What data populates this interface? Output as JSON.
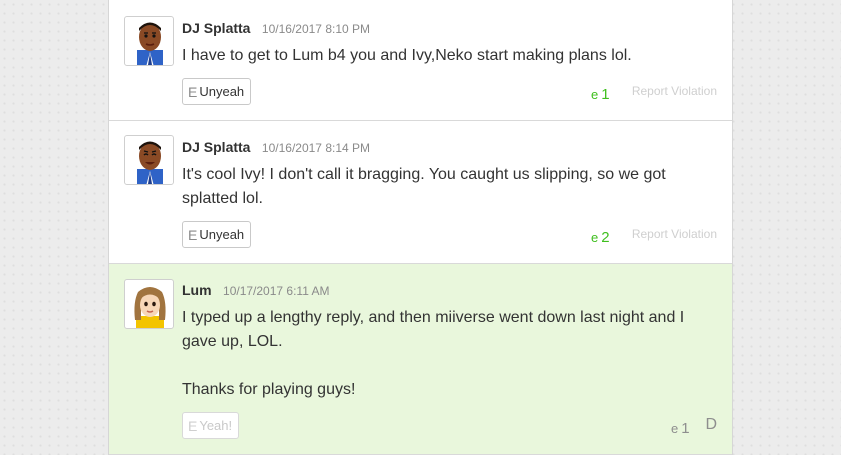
{
  "replies": [
    {
      "user": "DJ Splatta",
      "time": "10/16/2017 8:10 PM",
      "body": [
        "I have to get to Lum b4 you and Ivy,Neko start making plans lol."
      ],
      "yeah_icon": "E",
      "yeah_label": "Unyeah",
      "count_icon": "e",
      "count": "1",
      "report": "Report Violation"
    },
    {
      "user": "DJ Splatta",
      "time": "10/16/2017 8:14 PM",
      "body": [
        "It's cool Ivy! I don't call it bragging. You caught us slipping, so we got splatted lol."
      ],
      "yeah_icon": "E",
      "yeah_label": "Unyeah",
      "count_icon": "e",
      "count": "2",
      "report": "Report Violation"
    },
    {
      "user": "Lum",
      "time": "10/17/2017 6:11 AM",
      "body": [
        "I typed up a lengthy reply, and then miiverse went down last night and I gave up, LOL.",
        "Thanks for playing guys!"
      ],
      "yeah_icon": "E",
      "yeah_label": "Yeah!",
      "count_icon": "e",
      "count": "1",
      "menu_icon": "D"
    }
  ],
  "colors": {
    "highlight_bg": "#e9f7dc",
    "yeah_count_active": "#3fbf1e",
    "yeah_count_inactive": "#8e8e8e"
  },
  "icons": {
    "avatar_1": "mii-avatar-male-icon",
    "avatar_2": "mii-avatar-male-icon",
    "avatar_3": "mii-avatar-female-icon",
    "menu": "options-menu-icon"
  }
}
